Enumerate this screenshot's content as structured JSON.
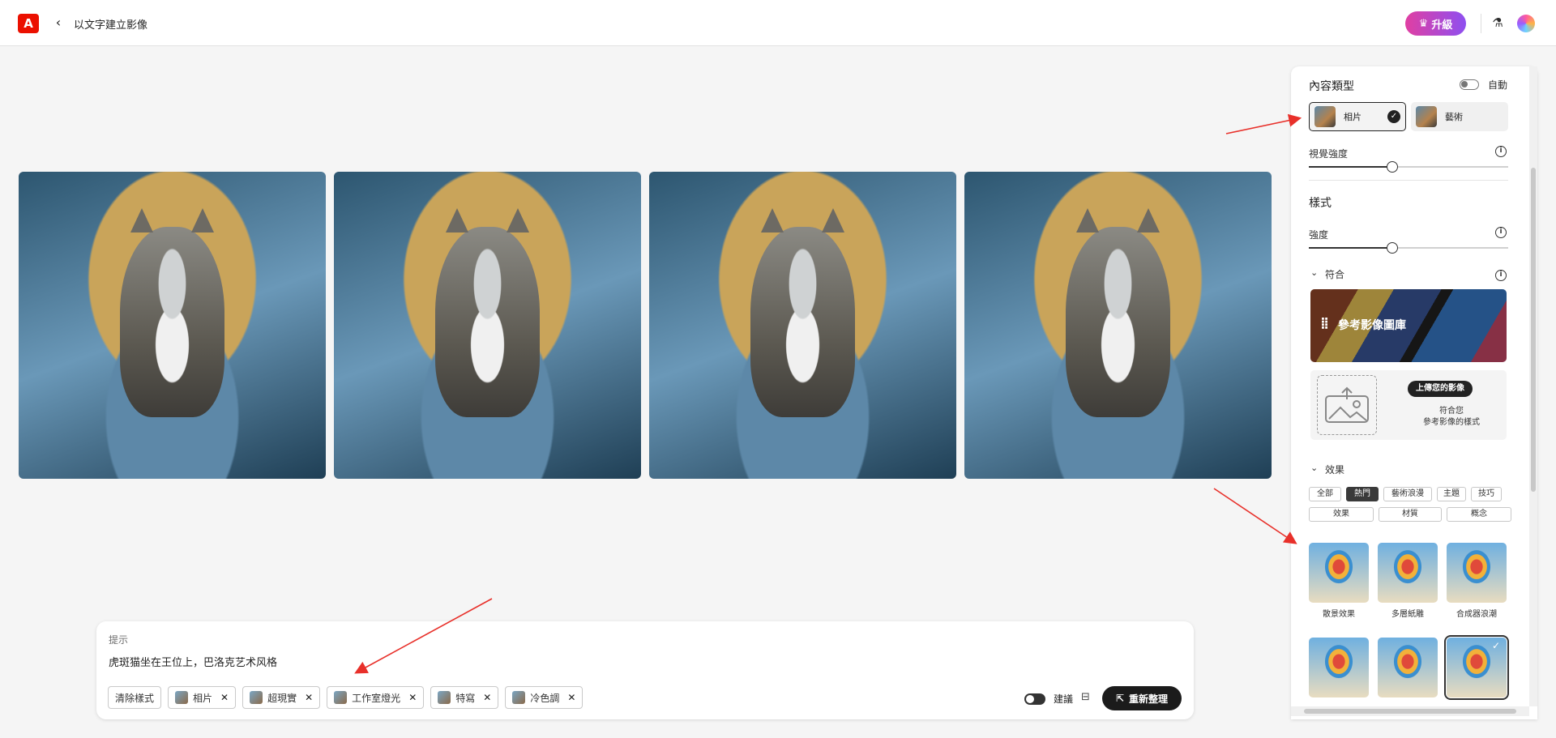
{
  "header": {
    "title": "以文字建立影像",
    "logo_text": "A",
    "upgrade_label": "升級"
  },
  "images": [
    {
      "alt": "cat-1"
    },
    {
      "alt": "cat-2"
    },
    {
      "alt": "cat-3"
    },
    {
      "alt": "cat-4"
    }
  ],
  "prompt": {
    "label": "提示",
    "text": "虎斑猫坐在王位上，巴洛克艺术风格",
    "chips": [
      {
        "label": "清除樣式",
        "thumb": false,
        "close": false
      },
      {
        "label": "相片",
        "thumb": true,
        "close": true
      },
      {
        "label": "超現實",
        "thumb": true,
        "close": true
      },
      {
        "label": "工作室燈光",
        "thumb": true,
        "close": true
      },
      {
        "label": "特寫",
        "thumb": true,
        "close": true
      },
      {
        "label": "冷色調",
        "thumb": true,
        "close": true
      }
    ],
    "suggest_label": "建議",
    "regenerate_label": "重新整理"
  },
  "panel": {
    "content_type": {
      "title": "內容類型",
      "auto_label": "自動",
      "photo_label": "相片",
      "art_label": "藝術"
    },
    "visual_intensity": {
      "label": "視覺強度",
      "value": 0.42
    },
    "style": {
      "title": "樣式",
      "intensity_label": "強度",
      "value": 0.42
    },
    "match": {
      "title": "符合",
      "gallery_label": "參考影像圖庫",
      "upload_button": "上傳您的影像",
      "upload_text1": "符合您",
      "upload_text2": "參考影像的樣式"
    },
    "effects": {
      "title": "效果",
      "tabs_row1": [
        "全部",
        "熱門",
        "藝術浪漫",
        "主題",
        "技巧"
      ],
      "active_tab": "熱門",
      "tabs_row2": [
        "效果",
        "材質",
        "概念"
      ],
      "items": [
        {
          "label": "散景效果",
          "selected": false
        },
        {
          "label": "多層紙雕",
          "selected": false
        },
        {
          "label": "合成器浪潮",
          "selected": false
        },
        {
          "label": "",
          "selected": false
        },
        {
          "label": "",
          "selected": false
        },
        {
          "label": "",
          "selected": true
        }
      ]
    }
  },
  "colors": {
    "accent_red": "#eb1000",
    "arrow_red": "#e8302a",
    "dark": "#1b1b1b"
  }
}
